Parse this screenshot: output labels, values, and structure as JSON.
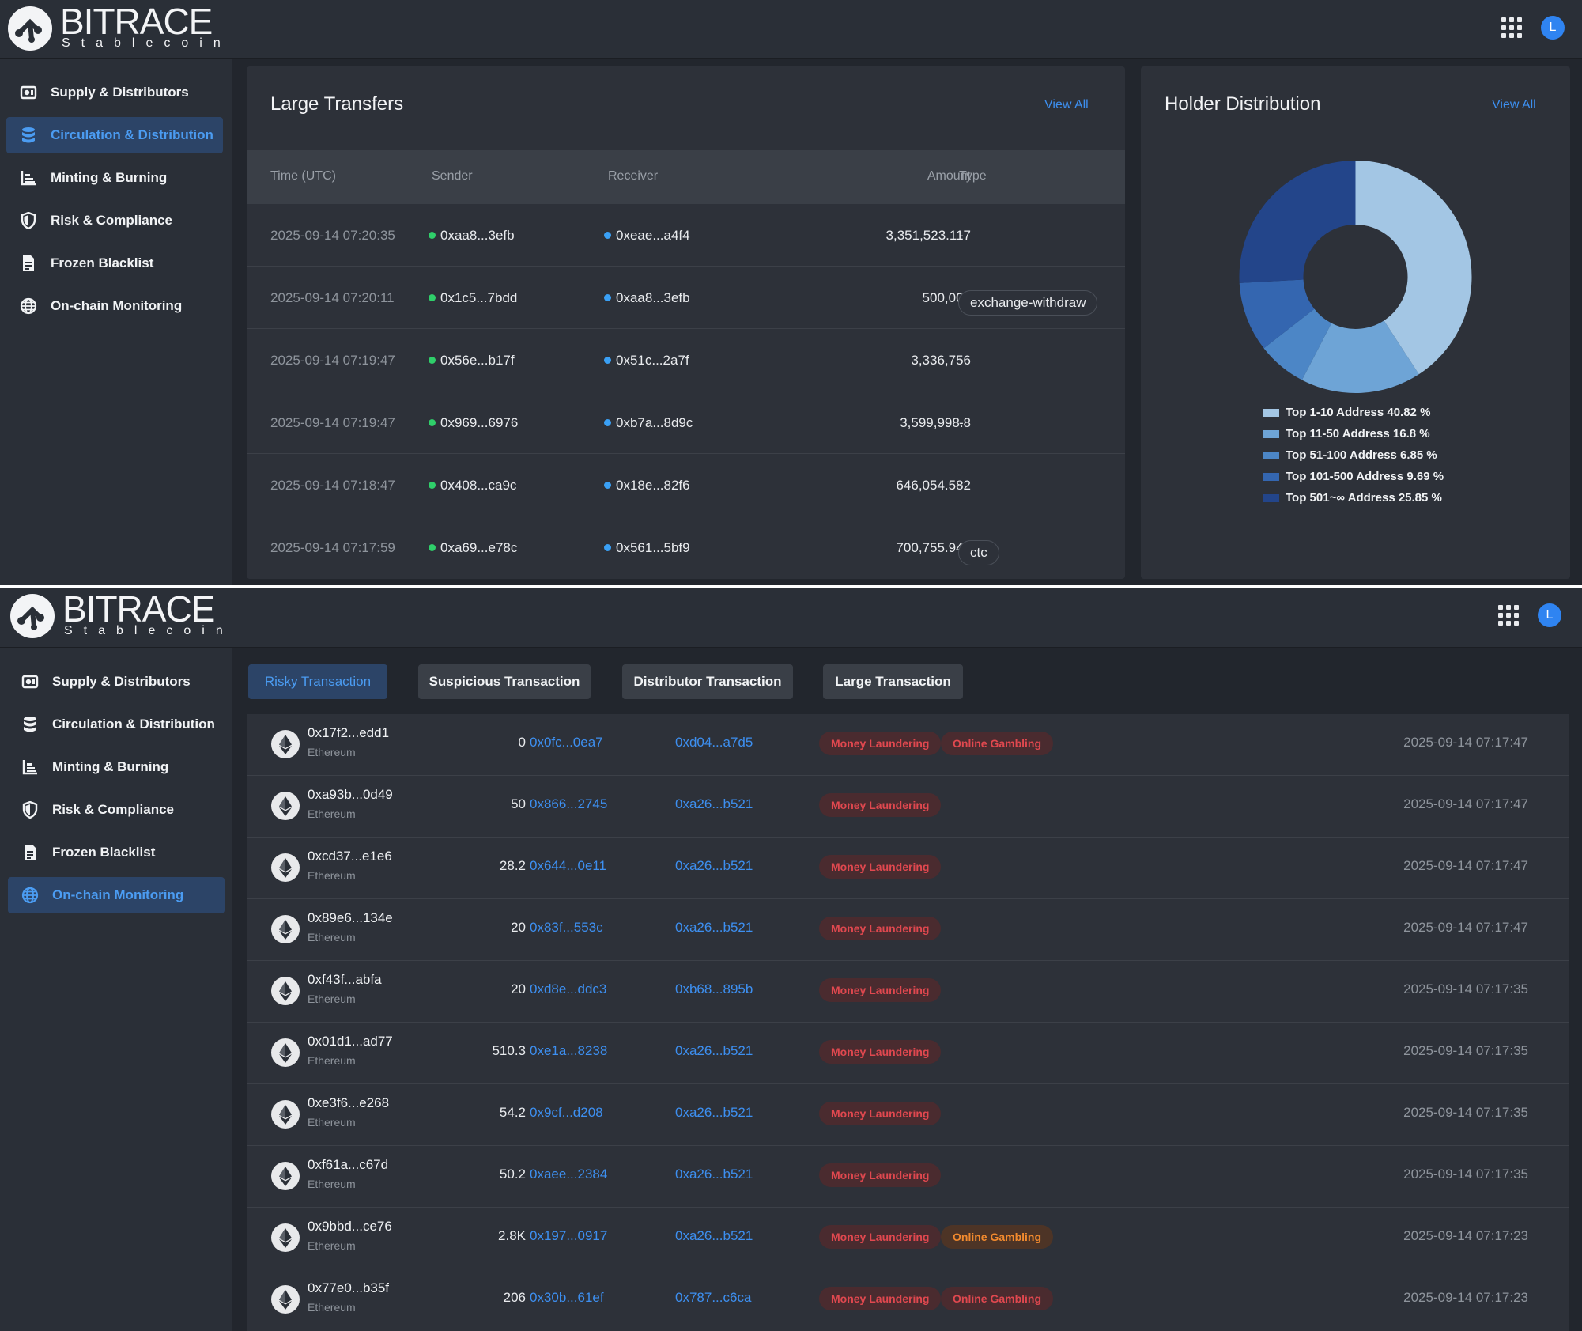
{
  "brand": {
    "name": "BITRACE",
    "subtitle": "Stablecoin"
  },
  "user": {
    "avatar_letter": "L"
  },
  "colors": {
    "accent": "#3d8ff0",
    "active_nav_bg": "#2c4467",
    "money_laundering": "#e0484f",
    "online_gambling": "#f28a2e",
    "sender_dot": "#2fcf6a",
    "receiver_dot": "#3aa0f5"
  },
  "nav": [
    {
      "label": "Supply & Distributors",
      "icon": "supply-icon"
    },
    {
      "label": "Circulation & Distribution",
      "icon": "database-icon"
    },
    {
      "label": "Minting & Burning",
      "icon": "bar-chart-icon"
    },
    {
      "label": "Risk & Compliance",
      "icon": "shield-icon"
    },
    {
      "label": "Frozen Blacklist",
      "icon": "document-icon"
    },
    {
      "label": "On-chain Monitoring",
      "icon": "globe-icon"
    }
  ],
  "screen1": {
    "active_nav": "Circulation & Distribution",
    "large_transfers": {
      "title": "Large Transfers",
      "view_all": "View All",
      "columns": [
        "Time (UTC)",
        "Sender",
        "Receiver",
        "Amount",
        "Type"
      ],
      "rows": [
        {
          "time": "2025-09-14 07:20:35",
          "sender": "0xaa8...3efb",
          "receiver": "0xeae...a4f4",
          "amount": "3,351,523.117",
          "type": "-"
        },
        {
          "time": "2025-09-14 07:20:11",
          "sender": "0x1c5...7bdd",
          "receiver": "0xaa8...3efb",
          "amount": "500,000",
          "type": "exchange-withdraw"
        },
        {
          "time": "2025-09-14 07:19:47",
          "sender": "0x56e...b17f",
          "receiver": "0x51c...2a7f",
          "amount": "3,336,756",
          "type": "-"
        },
        {
          "time": "2025-09-14 07:19:47",
          "sender": "0x969...6976",
          "receiver": "0xb7a...8d9c",
          "amount": "3,599,998.8",
          "type": "-"
        },
        {
          "time": "2025-09-14 07:18:47",
          "sender": "0x408...ca9c",
          "receiver": "0x18e...82f6",
          "amount": "646,054.582",
          "type": "-"
        },
        {
          "time": "2025-09-14 07:17:59",
          "sender": "0xa69...e78c",
          "receiver": "0x561...5bf9",
          "amount": "700,755.944",
          "type": "ctc"
        }
      ]
    },
    "holder_distribution": {
      "title": "Holder Distribution",
      "view_all": "View All",
      "chart_data": {
        "type": "pie",
        "title": "Holder Distribution",
        "donut": true,
        "categories": [
          "Top 1-10 Address",
          "Top 11-50 Address",
          "Top 51-100 Address",
          "Top 101-500 Address",
          "Top 501~∞ Address"
        ],
        "values": [
          40.82,
          16.8,
          6.85,
          9.69,
          25.85
        ],
        "unit": "%",
        "colors": [
          "#a3c6e4",
          "#6ea4d6",
          "#4c86c6",
          "#3466b0",
          "#23458a"
        ],
        "legend_position": "bottom"
      },
      "legend": [
        "Top 1-10 Address 40.82 %",
        "Top 11-50 Address 16.8 %",
        "Top 51-100 Address 6.85 %",
        "Top 101-500 Address 9.69 %",
        "Top 501~∞ Address 25.85 %"
      ]
    }
  },
  "screen2": {
    "active_nav": "On-chain Monitoring",
    "tabs": [
      "Risky Transaction",
      "Suspicious Transaction",
      "Distributor Transaction",
      "Large Transaction"
    ],
    "active_tab": "Risky Transaction",
    "rows": [
      {
        "hash": "0x17f2...edd1",
        "chain": "Ethereum",
        "amount": "0",
        "from": "0x0fc...0ea7",
        "to": "0xd04...a7d5",
        "tags": [
          "Money Laundering",
          "Online Gambling"
        ],
        "time": "2025-09-14 07:17:47"
      },
      {
        "hash": "0xa93b...0d49",
        "chain": "Ethereum",
        "amount": "50",
        "from": "0x866...2745",
        "to": "0xa26...b521",
        "tags": [
          "Money Laundering"
        ],
        "time": "2025-09-14 07:17:47"
      },
      {
        "hash": "0xcd37...e1e6",
        "chain": "Ethereum",
        "amount": "28.2",
        "from": "0x644...0e11",
        "to": "0xa26...b521",
        "tags": [
          "Money Laundering"
        ],
        "time": "2025-09-14 07:17:47"
      },
      {
        "hash": "0x89e6...134e",
        "chain": "Ethereum",
        "amount": "20",
        "from": "0x83f...553c",
        "to": "0xa26...b521",
        "tags": [
          "Money Laundering"
        ],
        "time": "2025-09-14 07:17:47"
      },
      {
        "hash": "0xf43f...abfa",
        "chain": "Ethereum",
        "amount": "20",
        "from": "0xd8e...ddc3",
        "to": "0xb68...895b",
        "tags": [
          "Money Laundering"
        ],
        "time": "2025-09-14 07:17:35"
      },
      {
        "hash": "0x01d1...ad77",
        "chain": "Ethereum",
        "amount": "510.3",
        "from": "0xe1a...8238",
        "to": "0xa26...b521",
        "tags": [
          "Money Laundering"
        ],
        "time": "2025-09-14 07:17:35"
      },
      {
        "hash": "0xe3f6...e268",
        "chain": "Ethereum",
        "amount": "54.2",
        "from": "0x9cf...d208",
        "to": "0xa26...b521",
        "tags": [
          "Money Laundering"
        ],
        "time": "2025-09-14 07:17:35"
      },
      {
        "hash": "0xf61a...c67d",
        "chain": "Ethereum",
        "amount": "50.2",
        "from": "0xaee...2384",
        "to": "0xa26...b521",
        "tags": [
          "Money Laundering"
        ],
        "time": "2025-09-14 07:17:35"
      },
      {
        "hash": "0x9bbd...ce76",
        "chain": "Ethereum",
        "amount": "2.8K",
        "from": "0x197...0917",
        "to": "0xa26...b521",
        "tags": [
          "Money Laundering",
          "Online Gambling"
        ],
        "tag_styles": [
          "red",
          "orange"
        ],
        "time": "2025-09-14 07:17:23"
      },
      {
        "hash": "0x77e0...b35f",
        "chain": "Ethereum",
        "amount": "206",
        "from": "0x30b...61ef",
        "to": "0x787...c6ca",
        "tags": [
          "Money Laundering",
          "Online Gambling"
        ],
        "time": "2025-09-14 07:17:23"
      }
    ]
  }
}
